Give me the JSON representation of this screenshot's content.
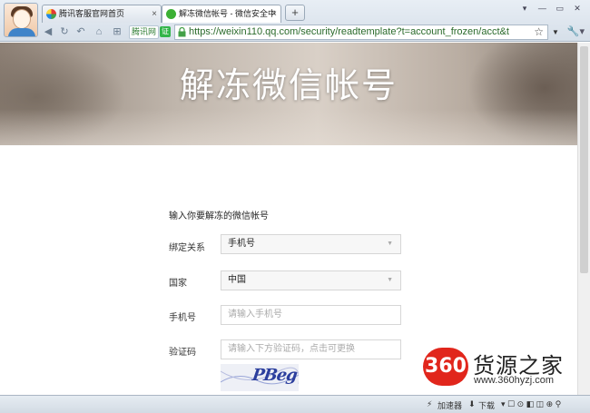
{
  "browser": {
    "tabs": [
      {
        "label": "腾讯客服官网首页",
        "close": "×"
      },
      {
        "label": "解冻微信帐号 - 微信安全中",
        "close": "×"
      }
    ],
    "new_tab": "+",
    "site_chip": "腾讯网",
    "ok_chip": "证",
    "url": "https://weixin110.qq.com/security/readtemplate?t=account_frozen/acct&t",
    "status": {
      "accelerator": "加速器",
      "download": "下载"
    }
  },
  "page": {
    "banner_title": "解冻微信帐号",
    "form_heading": "输入你要解冻的微信帐号",
    "rows": [
      {
        "label": "绑定关系",
        "value": "手机号"
      },
      {
        "label": "国家",
        "value": "中国"
      },
      {
        "label": "手机号",
        "placeholder": "请输入手机号"
      },
      {
        "label": "验证码",
        "placeholder": "请输入下方验证码，点击可更换"
      }
    ],
    "captcha_text": "PBeg"
  },
  "watermark": {
    "badge": "360",
    "name": "货源之家",
    "url": "www.360hyzj.com"
  },
  "colors": {
    "watermark_red": "#e1261c",
    "url_green": "#2a6a2a",
    "captcha_blue": "#2c3f9e"
  },
  "icons": [
    "back-icon",
    "refresh-icon",
    "undo-icon",
    "home-icon",
    "grid-icon",
    "lock-icon",
    "star-icon",
    "dropdown-icon",
    "tools-icon",
    "minimize-icon",
    "maximize-icon",
    "close-icon"
  ]
}
